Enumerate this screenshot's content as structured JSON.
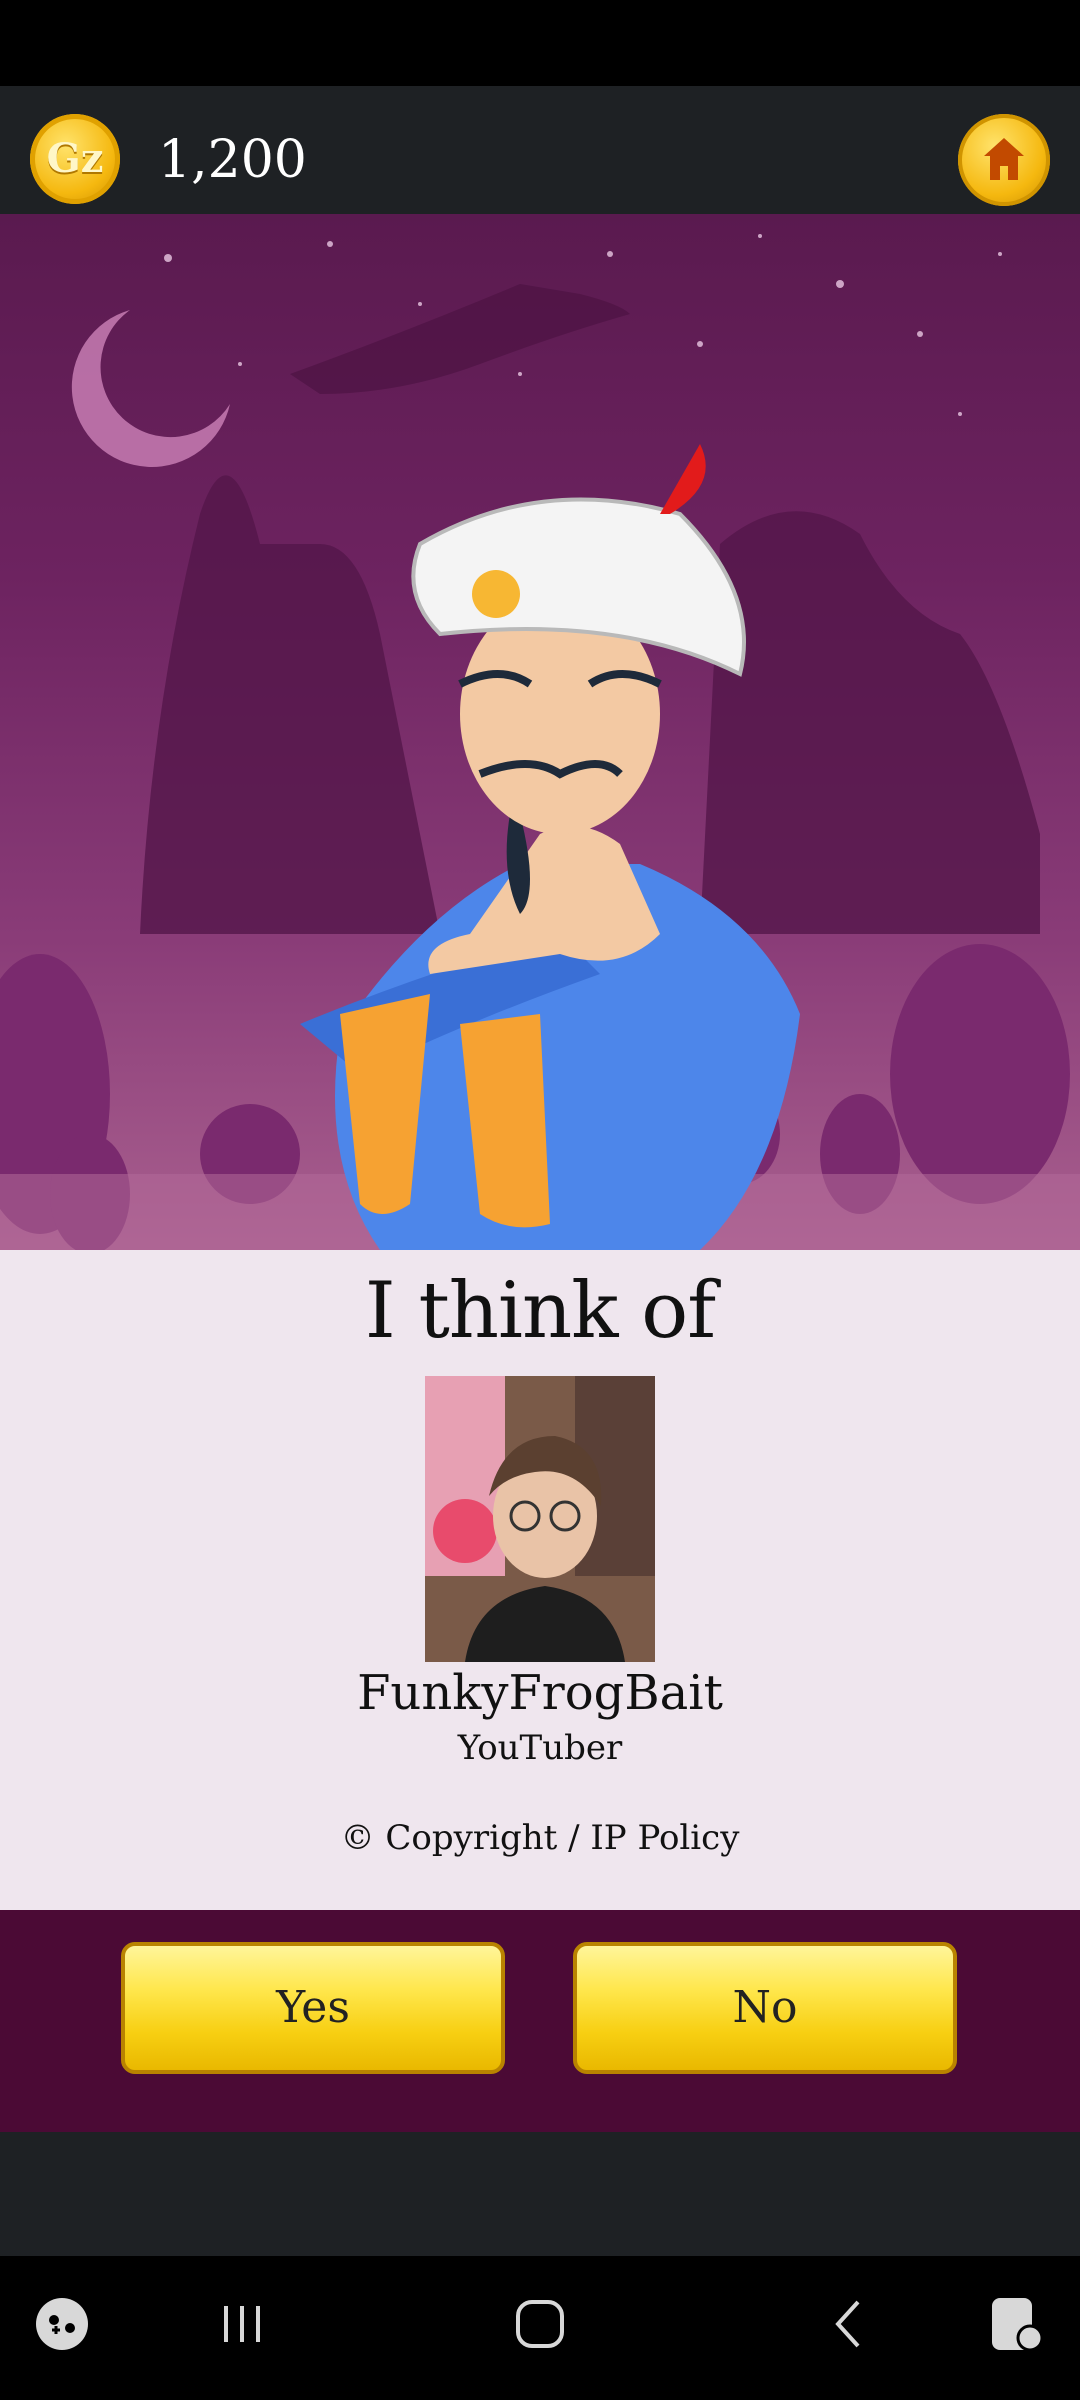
{
  "header": {
    "coins": "1,200",
    "coin_icon": "gz-coin-icon",
    "home_icon": "home-icon"
  },
  "result": {
    "title": "I think of",
    "name": "FunkyFrogBait",
    "description": "YouTuber",
    "copyright": "© Copyright / IP Policy"
  },
  "answers": {
    "yes": "Yes",
    "no": "No"
  },
  "navbar": {
    "icons": [
      "game-launcher-icon",
      "recents-icon",
      "home-circle-icon",
      "back-icon",
      "screen-lock-icon"
    ]
  },
  "colors": {
    "button_yellow": "#f7cf12",
    "panel_bg": "#efe6ee",
    "scene_purple": "#6d2360",
    "button_area_bg": "#4b0a35"
  }
}
